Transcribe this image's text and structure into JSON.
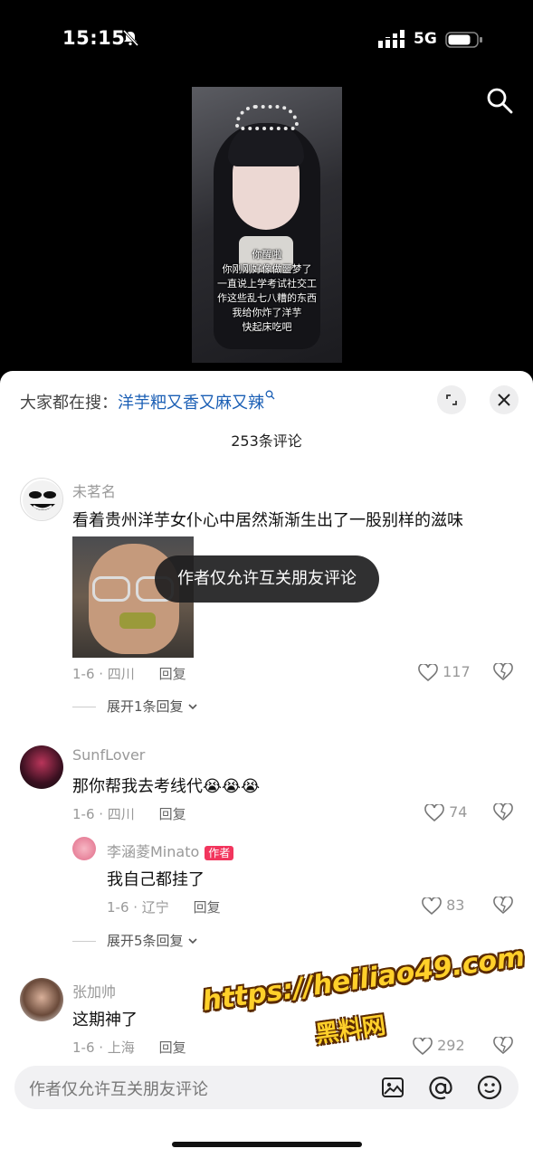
{
  "status_bar": {
    "time": "15:15",
    "network": "5G"
  },
  "video": {
    "captions": [
      "你醒啦",
      "你刚刚好像做噩梦了",
      "一直说上学考试社交工",
      "作这些乱七八糟的东西",
      "我给你炸了洋芋",
      "快起床吃吧"
    ]
  },
  "comments_panel": {
    "hot_search_label": "大家都在搜：",
    "hot_search_term": "洋芋粑又香又麻又辣",
    "comment_count": "253条评论"
  },
  "toast": "作者仅允许互关朋友评论",
  "comments": [
    {
      "username": "未茗名",
      "text": "看着贵州洋芋女仆心中居然渐渐生出了一股别样的滋味",
      "date_location": "1-6 · 四川",
      "reply_label": "回复",
      "likes": "117",
      "expand": "展开1条回复"
    },
    {
      "username": "SunfLover",
      "text": "那你帮我去考线代😭😭😭",
      "date_location": "1-6 · 四川",
      "reply_label": "回复",
      "likes": "74",
      "sub_reply": {
        "username": "李涵菱Minato",
        "badge": "作者",
        "text": "我自己都挂了",
        "date_location": "1-6 · 辽宁",
        "reply_label": "回复",
        "likes": "83"
      },
      "expand": "展开5条回复"
    },
    {
      "username": "张加帅",
      "text": "这期神了",
      "date_location": "1-6 · 上海",
      "reply_label": "回复",
      "likes": "292"
    }
  ],
  "input": {
    "placeholder": "作者仅允许互关朋友评论"
  },
  "watermark": {
    "line1": "https://heiliao49.com",
    "line2": "黑料网"
  },
  "colors": {
    "accent_link": "#1b5fb5",
    "author_badge": "#f2355d",
    "watermark": "#ffd02a"
  }
}
